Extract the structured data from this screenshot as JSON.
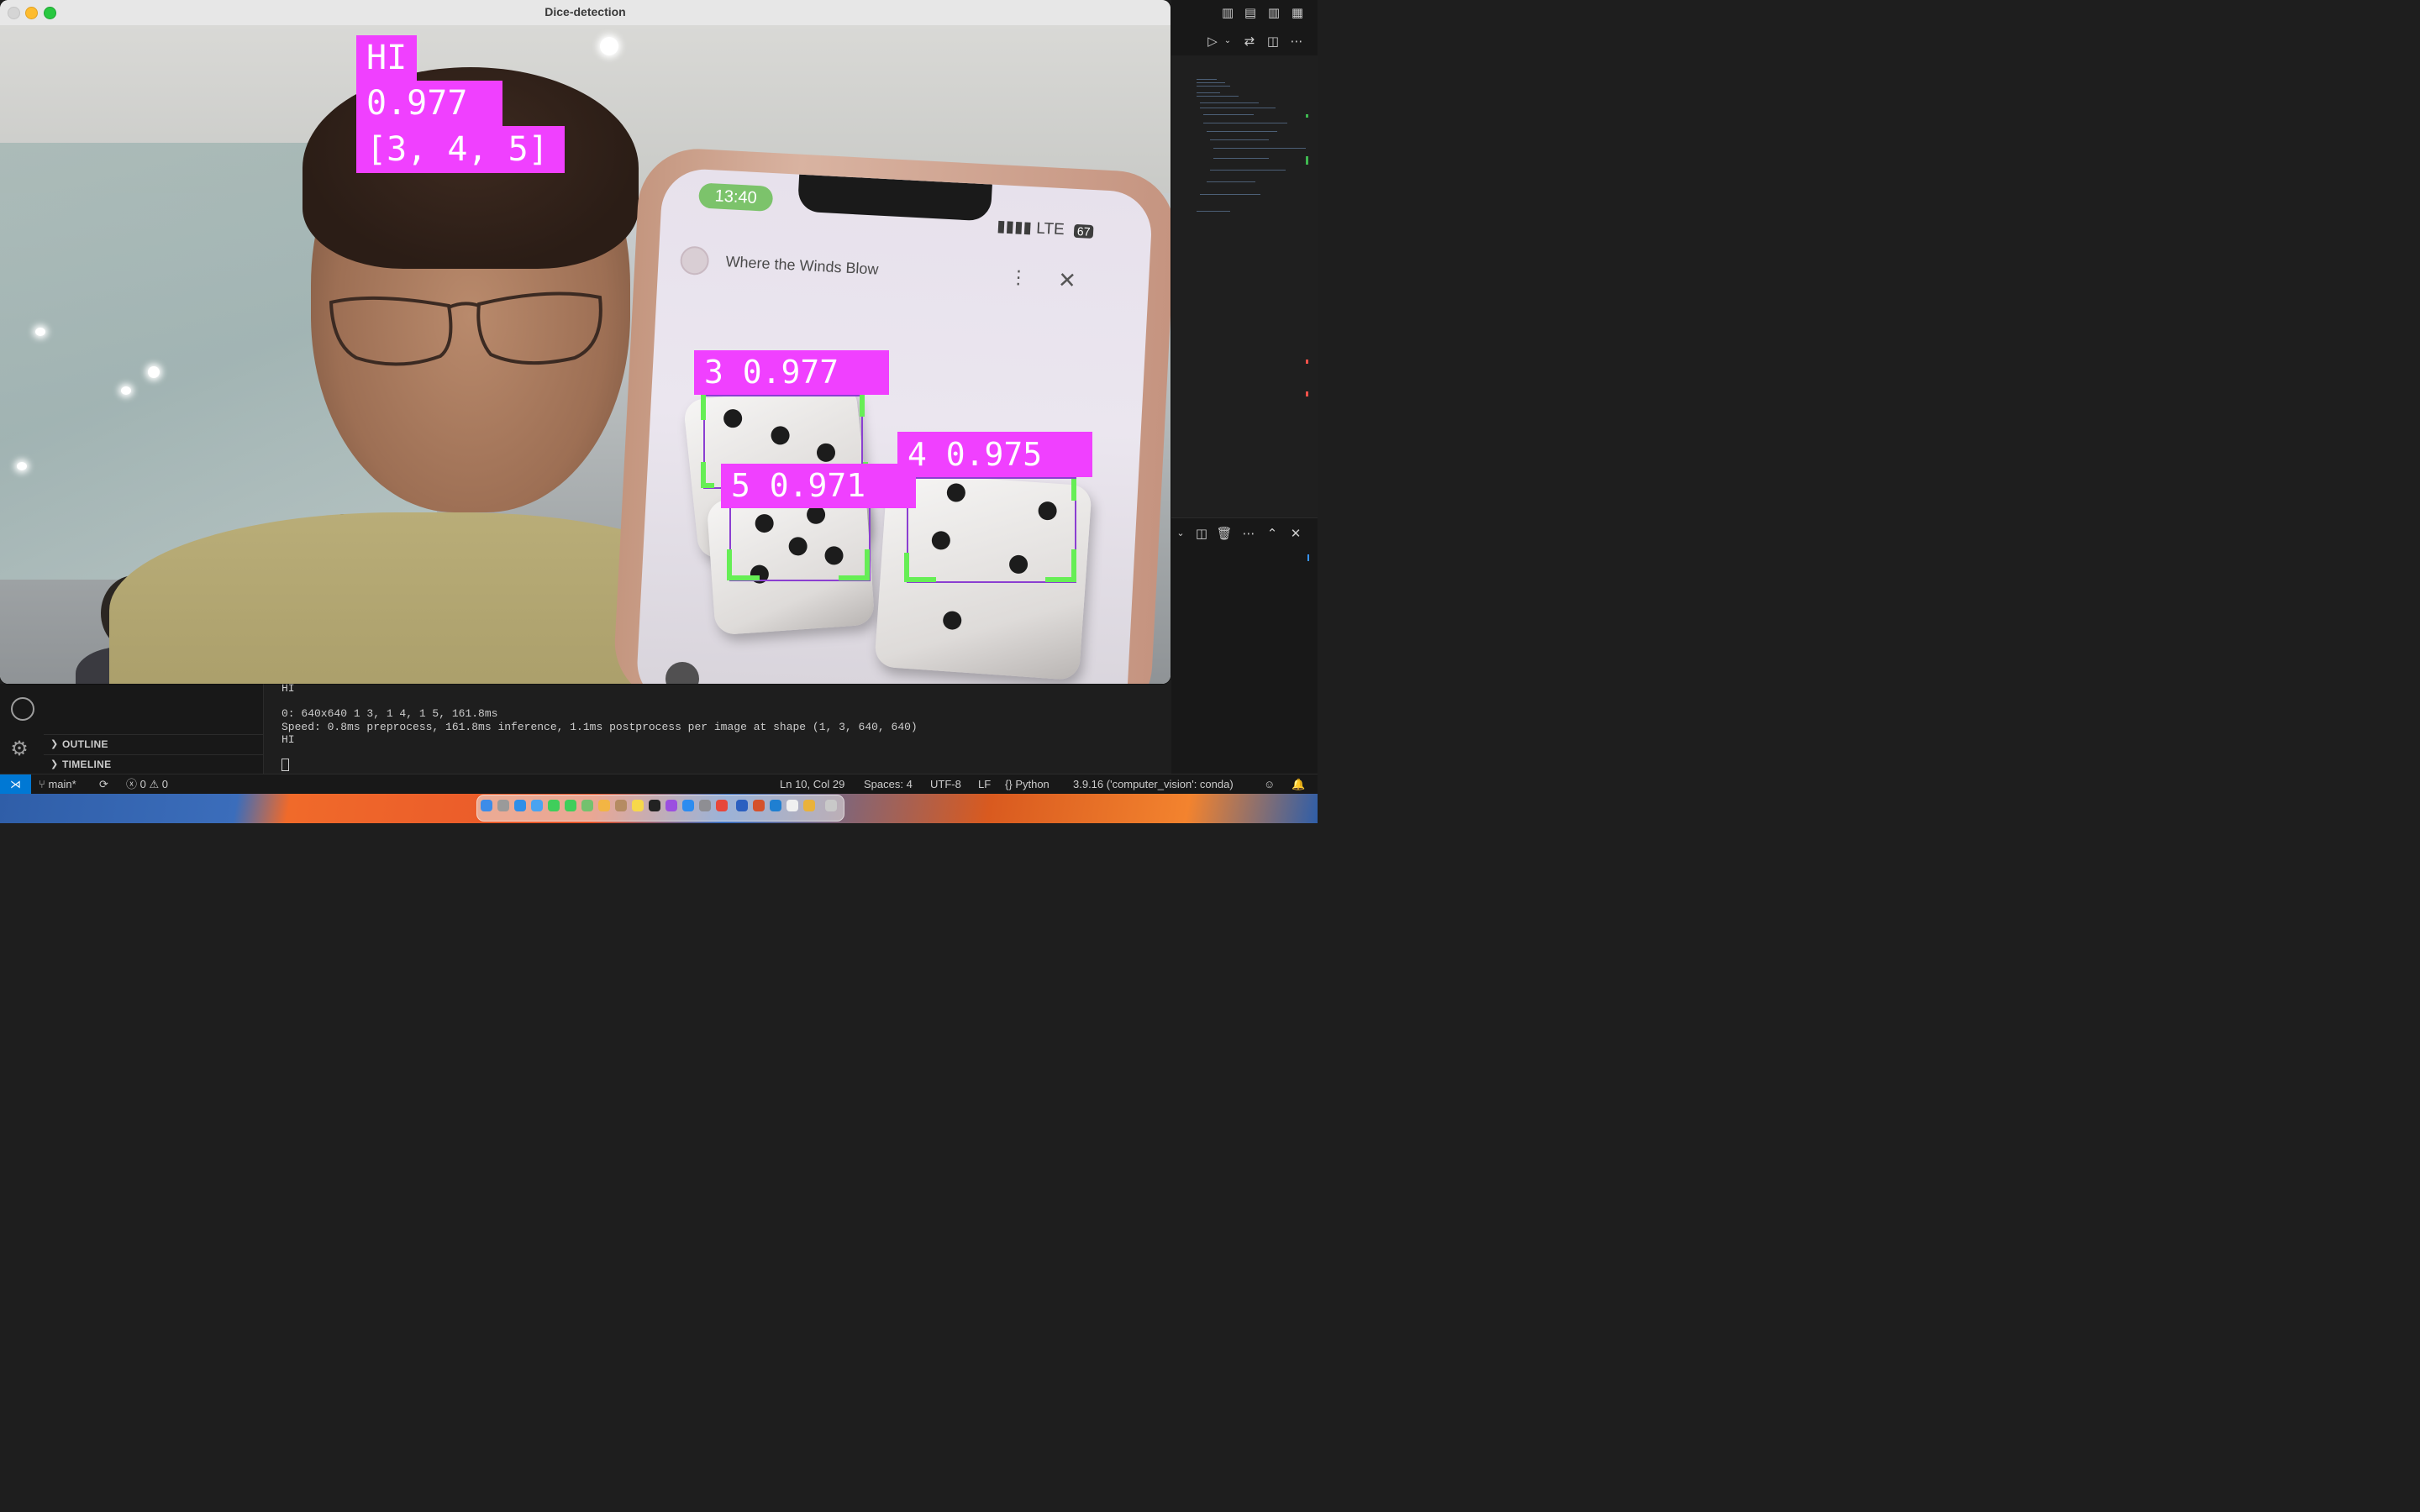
{
  "window": {
    "title": "Dice-detection"
  },
  "overlay": {
    "class_label": "HI",
    "confidence": "0.977",
    "faces": "[3, 4, 5]"
  },
  "phone": {
    "time": "13:40",
    "network": "LTE",
    "battery": "67",
    "sheet_title": "Where the Winds Blow",
    "menu_glyph": "⋮",
    "close_glyph": "✕"
  },
  "detections": [
    {
      "label": "3 0.977"
    },
    {
      "label": "5 0.971"
    },
    {
      "label": "4 0.975"
    }
  ],
  "terminal": {
    "lines": [
      "HI",
      "",
      "0: 640x640 1 3, 1 4, 1 5, 161.8ms",
      "Speed: 0.8ms preprocess, 161.8ms inference, 1.1ms postprocess per image at shape (1, 3, 640, 640)",
      "HI"
    ]
  },
  "sidebar": {
    "outline": "OUTLINE",
    "timeline": "TIMELINE"
  },
  "statusbar": {
    "branch": "main*",
    "errors": "0",
    "warnings": "0",
    "position": "Ln 10, Col 29",
    "spaces": "Spaces: 4",
    "encoding": "UTF-8",
    "eol": "LF",
    "language": "Python",
    "interpreter": "3.9.16 ('computer_vision': conda)"
  },
  "colors": {
    "label_bg": "#f040ff",
    "box_corner": "#66ee55",
    "statusbar_remote": "#0078d4"
  }
}
